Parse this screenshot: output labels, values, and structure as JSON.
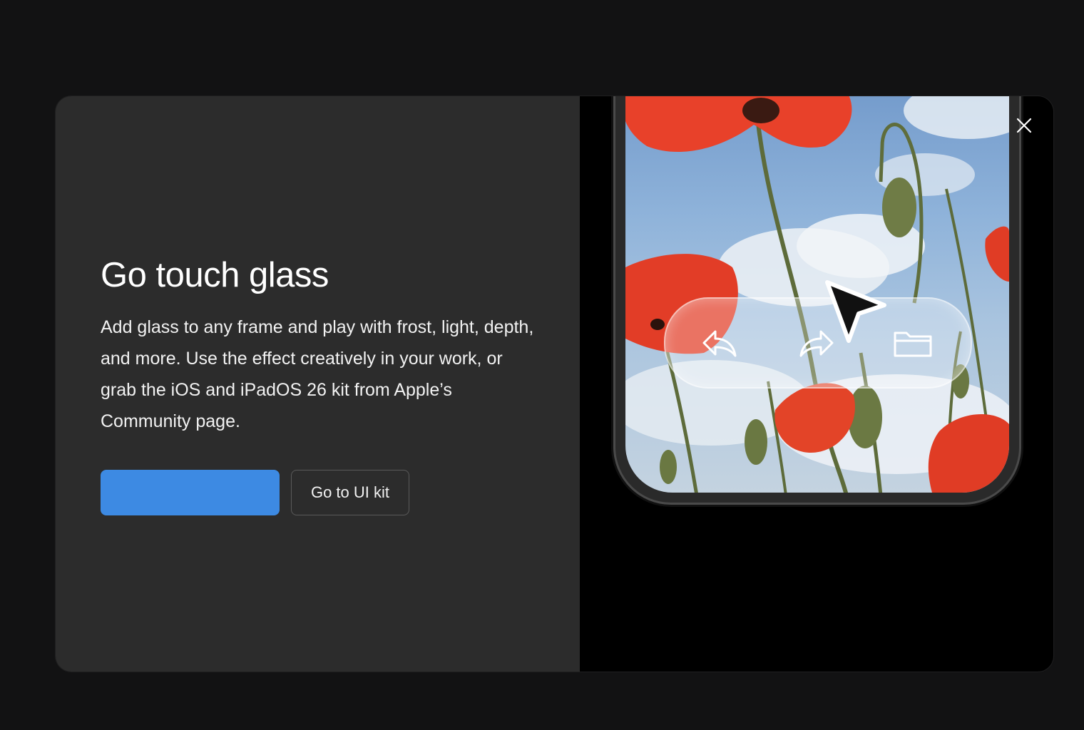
{
  "modal": {
    "title": "Go touch glass",
    "description": "Add glass to any frame and play with frost, light, depth, and more. Use the effect creatively in your work, or grab the iOS and iPadOS 26 kit from Apple’s Community page.",
    "secondary_button_label": "Go to UI kit"
  },
  "icons": {
    "close": "close-icon",
    "undo": "undo-icon",
    "redo": "redo-icon",
    "folder": "folder-icon",
    "cursor": "cursor-icon"
  },
  "colors": {
    "modal_left_bg": "#2c2c2c",
    "primary_button": "#3d8ae3",
    "page_bg": "#121213",
    "poppy_red": "#e8412a"
  }
}
